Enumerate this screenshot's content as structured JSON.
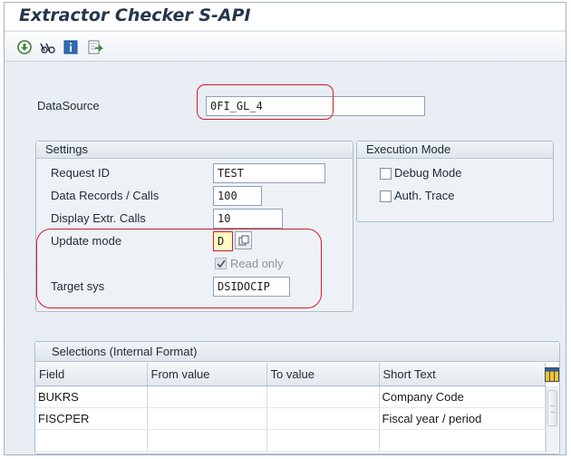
{
  "window": {
    "title": "Extractor Checker S-API"
  },
  "toolbar": {
    "icons": [
      "execute-icon",
      "glasses-icon",
      "info-icon",
      "export-icon"
    ]
  },
  "datasource": {
    "label": "DataSource",
    "value": "0FI_GL_4"
  },
  "settings": {
    "header": "Settings",
    "request_id": {
      "label": "Request ID",
      "value": "TEST"
    },
    "data_records": {
      "label": "Data Records / Calls",
      "value": "100"
    },
    "display_calls": {
      "label": "Display Extr. Calls",
      "value": "10"
    },
    "update_mode": {
      "label": "Update mode",
      "value": "D"
    },
    "read_only": {
      "label": "Read only",
      "checked": true
    },
    "target_sys": {
      "label": "Target sys",
      "value": "DSIDOCIP"
    }
  },
  "execution_mode": {
    "header": "Execution Mode",
    "debug_mode": {
      "label": "Debug Mode",
      "checked": false
    },
    "auth_trace": {
      "label": "Auth. Trace",
      "checked": false
    }
  },
  "selections": {
    "header": "Selections (Internal Format)",
    "columns": [
      "Field",
      "From value",
      "To value",
      "Short Text"
    ],
    "rows": [
      {
        "field": "BUKRS",
        "from": "",
        "to": "",
        "short_text": "Company Code"
      },
      {
        "field": "FISCPER",
        "from": "",
        "to": "",
        "short_text": "Fiscal year / period"
      },
      {
        "field": "",
        "from": "",
        "to": "",
        "short_text": ""
      }
    ]
  },
  "colors": {
    "highlight": "#d21a2c",
    "title": "#25364d"
  }
}
